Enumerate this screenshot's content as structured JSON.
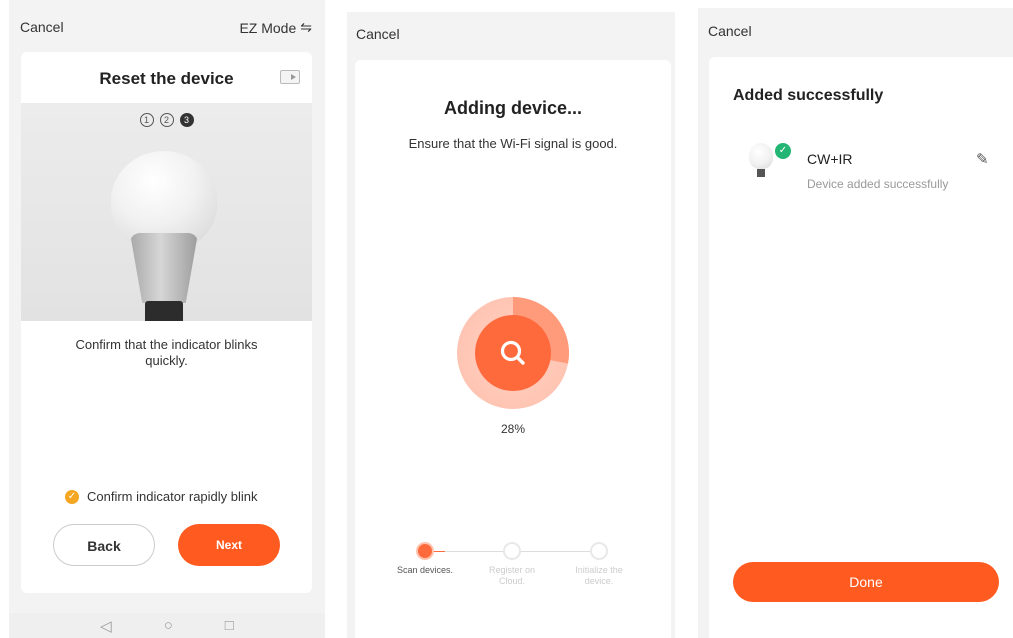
{
  "screen1": {
    "cancel_label": "Cancel",
    "mode_label": "EZ Mode",
    "mode_icon": "⇋",
    "title": "Reset the device",
    "steps": [
      "①",
      "②",
      "3"
    ],
    "instruction": "Confirm that the indicator blinks quickly.",
    "confirm_label": "Confirm indicator rapidly blink",
    "back_label": "Back",
    "next_label": "Next",
    "nav": {
      "back": "◁",
      "home": "○",
      "recent": "□"
    }
  },
  "screen2": {
    "cancel_label": "Cancel",
    "title": "Adding device...",
    "subtitle": "Ensure that the Wi-Fi signal is good.",
    "progress": 28,
    "progress_label": "28%",
    "steps": [
      {
        "label": "Scan devices."
      },
      {
        "label": "Register on Cloud."
      },
      {
        "label": "Initialize the device."
      }
    ]
  },
  "screen3": {
    "cancel_label": "Cancel",
    "title": "Added successfully",
    "device_name": "CW+IR",
    "device_status": "Device added successfully",
    "done_label": "Done"
  },
  "colors": {
    "accent": "#ff5a1f",
    "success": "#22b573",
    "warning": "#f5a623"
  }
}
